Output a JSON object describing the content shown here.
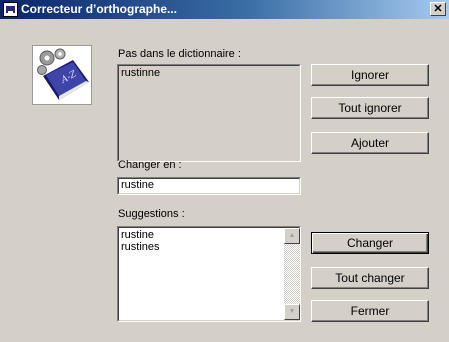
{
  "window": {
    "title": "Correcteur d’orthographe...",
    "close_glyph": "✕"
  },
  "logo": {
    "icon": "book-gears-icon",
    "book_text": "A-Z"
  },
  "not_in_dict": {
    "label": "Pas dans le dictionnaire :",
    "value": "rustinne"
  },
  "change_to": {
    "label": "Changer en :",
    "value": "rustine"
  },
  "suggestions": {
    "label": "Suggestions :",
    "items": [
      "rustine",
      "rustines"
    ]
  },
  "buttons": {
    "ignore": "Ignorer",
    "ignore_all": "Tout ignorer",
    "add": "Ajouter",
    "change": "Changer",
    "change_all": "Tout changer",
    "close": "Fermer"
  }
}
